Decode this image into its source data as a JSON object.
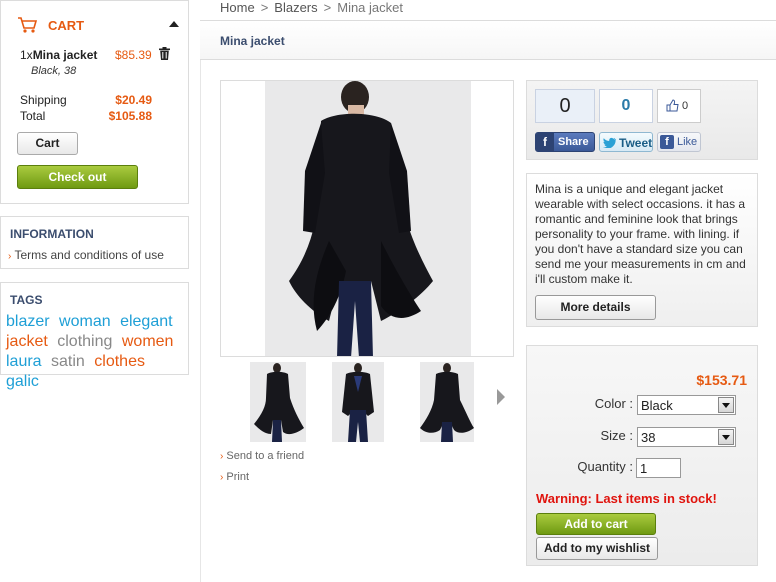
{
  "cart": {
    "title": "CART",
    "item_qty": "1x",
    "item_name": "Mina jacket",
    "item_price": "$85.39",
    "item_attributes": "Black, 38",
    "shipping_label": "Shipping",
    "shipping_value": "$20.49",
    "total_label": "Total",
    "total_value": "$105.88",
    "cart_button": "Cart",
    "checkout_button": "Check out"
  },
  "information": {
    "title": "INFORMATION",
    "link": "Terms and conditions of use"
  },
  "tags": {
    "title": "TAGS",
    "items": [
      {
        "label": "blazer",
        "color": "#1e9fd6"
      },
      {
        "label": "woman",
        "color": "#1e9fd6"
      },
      {
        "label": "elegant",
        "color": "#1e9fd6"
      },
      {
        "label": "jacket",
        "color": "#e65a12"
      },
      {
        "label": "clothing",
        "color": "#888888"
      },
      {
        "label": "women",
        "color": "#e65a12"
      },
      {
        "label": "laura",
        "color": "#1e9fd6"
      },
      {
        "label": "satin",
        "color": "#888888"
      },
      {
        "label": "clothes",
        "color": "#e65a12"
      },
      {
        "label": "galic",
        "color": "#1e9fd6"
      }
    ]
  },
  "breadcrumb": {
    "home": "Home",
    "sep": ">",
    "category": "Blazers",
    "current": "Mina jacket"
  },
  "product": {
    "title": "Mina jacket",
    "send_to_friend": "Send to a friend",
    "print": "Print",
    "description": "Mina is a unique and elegant jacket wearable with select occasions. it has a romantic and feminine look that brings personality to your frame. with lining. if you don't have a standard size you can send me your measurements in cm and i'll custom make it.",
    "more_details": "More details",
    "price": "$153.71",
    "color_label": "Color :",
    "color_value": "Black",
    "size_label": "Size :",
    "size_value": "38",
    "quantity_label": "Quantity :",
    "quantity_value": "1",
    "warning": "Warning: Last items in stock!",
    "add_to_cart": "Add to cart",
    "add_to_wishlist": "Add to my wishlist"
  },
  "social": {
    "fb_share_count": "0",
    "tweet_count": "0",
    "like_count": "0",
    "share_label": "Share",
    "tweet_label": "Tweet",
    "like_label": "Like"
  }
}
